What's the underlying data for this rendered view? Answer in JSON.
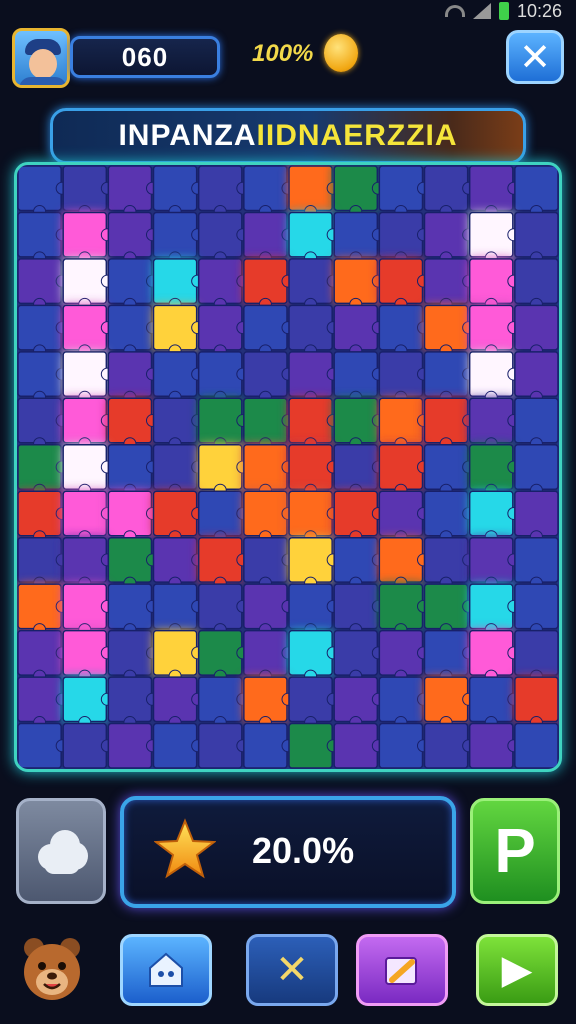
{
  "status_bar": {
    "time": "10:26"
  },
  "header": {
    "score": "060",
    "percent": "100%",
    "close_label": "✕"
  },
  "title": {
    "part1": "INPANZA ",
    "part2": "IIDNAERZZIA"
  },
  "puzzle": {
    "colors": {
      "blue": "#2f48b4",
      "indigo": "#3a3ca8",
      "purple": "#5a34b0",
      "green": "#1c8a4a",
      "orange": "#ff6a1a",
      "red": "#e63a2a",
      "yellow": "#ffd23a",
      "pink": "#ff5ad8",
      "cyan": "#28d8e8",
      "white": "#fff6ff"
    }
  },
  "controls": {
    "progress_text": "20.0%",
    "p_label": "P"
  },
  "bottom": {
    "cancel_label": "✕",
    "play_label": "▶"
  }
}
